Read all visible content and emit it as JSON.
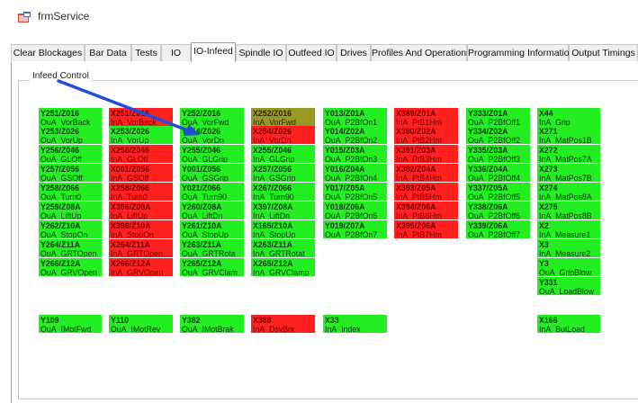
{
  "window": {
    "title": "frmService",
    "icon": "app-form-icon"
  },
  "tabs": [
    {
      "label": "Clear Blockages",
      "active": false
    },
    {
      "label": "Bar Data",
      "active": false
    },
    {
      "label": "Tests",
      "active": false
    },
    {
      "label": "IO",
      "active": false
    },
    {
      "label": "IO-Infeed",
      "active": true
    },
    {
      "label": "Spindle IO",
      "active": false
    },
    {
      "label": "Outfeed IO",
      "active": false
    },
    {
      "label": "Drives",
      "active": false
    },
    {
      "label": "Profiles And Operations",
      "active": false
    },
    {
      "label": "Programming Information",
      "active": false
    },
    {
      "label": "Output Timings",
      "active": false
    }
  ],
  "group": {
    "label": "Infeed Control"
  },
  "colors": {
    "on": "#22ee22",
    "off": "#ff2020",
    "forced": "#999922",
    "annotation_arrow": "#1f4fd8"
  },
  "annotation": {
    "type": "arrow",
    "icon": "pointer-arrow-icon",
    "color": "#1f4fd8"
  },
  "columns": [
    [
      {
        "addr": "Y251/Z016",
        "sig": "OuA_VorBack",
        "state": "on"
      },
      {
        "addr": "Y253/Z026",
        "sig": "OuA_VorUp",
        "state": "on"
      },
      {
        "addr": "Y256/Z046",
        "sig": "OuA_GLOff",
        "state": "on"
      },
      {
        "addr": "Y257/Z056",
        "sig": "OuA_GSOff",
        "state": "on"
      },
      {
        "addr": "Y258/Z066",
        "sig": "OuA_Turn0",
        "state": "on"
      },
      {
        "addr": "Y259/Z08A",
        "sig": "OuA_LiftUp",
        "state": "on"
      },
      {
        "addr": "Y262/Z10A",
        "sig": "OuA_StopOn",
        "state": "on"
      },
      {
        "addr": "Y264/Z11A",
        "sig": "OuA_GRTOpen",
        "state": "on"
      },
      {
        "addr": "Y266/Z12A",
        "sig": "OuA_GRVOpen",
        "state": "on"
      },
      {
        "gap": true
      },
      {
        "addr": "Y109",
        "sig": "OuA_IMotFwd",
        "state": "on"
      }
    ],
    [
      {
        "addr": "X251/Z016",
        "sig": "InA_VorBack",
        "state": "off"
      },
      {
        "addr": "X253/Z026",
        "sig": "InA_VorUp",
        "state": "on"
      },
      {
        "addr": "X256/Z046",
        "sig": "InA_GLOff",
        "state": "off"
      },
      {
        "addr": "X001/Z056",
        "sig": "InA_GSOff",
        "state": "off"
      },
      {
        "addr": "X258/Z066",
        "sig": "InA_Turn0",
        "state": "off"
      },
      {
        "addr": "X396/Z08A",
        "sig": "InA_LiftUp",
        "state": "off"
      },
      {
        "addr": "X398/Z10A",
        "sig": "InA_StopOn",
        "state": "off"
      },
      {
        "addr": "X264/Z11A",
        "sig": "InA_GRTOpen",
        "state": "off"
      },
      {
        "addr": "X266/Z12A",
        "sig": "InA_GRVOpen",
        "state": "off"
      },
      {
        "gap": true
      },
      {
        "addr": "Y110",
        "sig": "OuA_IMotRev",
        "state": "on"
      }
    ],
    [
      {
        "addr": "Y252/Z016",
        "sig": "OuA_VorFwd",
        "state": "on"
      },
      {
        "addr": "Y254/Z026",
        "sig": "OuA_VorDn",
        "state": "on"
      },
      {
        "addr": "Y255/Z046",
        "sig": "OuA_GLGrip",
        "state": "on"
      },
      {
        "addr": "Y001/Z056",
        "sig": "OuA_GSGrip",
        "state": "on"
      },
      {
        "addr": "Y021/Z066",
        "sig": "OuA_Turn90",
        "state": "on"
      },
      {
        "addr": "Y260/Z08A",
        "sig": "OuA_LiftDn",
        "state": "on"
      },
      {
        "addr": "Y261/Z10A",
        "sig": "OuA_StopUp",
        "state": "on"
      },
      {
        "addr": "Y263/Z11A",
        "sig": "OuA_GRTRota",
        "state": "on"
      },
      {
        "addr": "Y265/Z12A",
        "sig": "OuA_GRVClam",
        "state": "on"
      },
      {
        "gap": true
      },
      {
        "addr": "Y382",
        "sig": "OuA_IMotBrak",
        "state": "on"
      }
    ],
    [
      {
        "addr": "X252/Z016",
        "sig": "InA_VorFwd",
        "state": "forced"
      },
      {
        "addr": "X254/Z026",
        "sig": "InA_VorDn",
        "state": "off"
      },
      {
        "addr": "X255/Z046",
        "sig": "InA_GLGrip",
        "state": "on"
      },
      {
        "addr": "X257/Z056",
        "sig": "InA_GSGrip",
        "state": "on"
      },
      {
        "addr": "X267/Z066",
        "sig": "InA_Turn90",
        "state": "on"
      },
      {
        "addr": "X397/Z08A",
        "sig": "InA_LiftDn",
        "state": "on"
      },
      {
        "addr": "X165/Z10A",
        "sig": "InA_StopUp",
        "state": "on"
      },
      {
        "addr": "X263/Z11A",
        "sig": "InA_GRTRotat",
        "state": "on"
      },
      {
        "addr": "X265/Z12A",
        "sig": "InA_GRVClamp",
        "state": "on"
      },
      {
        "gap": true
      },
      {
        "addr": "X388",
        "sig": "InA_DsvBrk",
        "state": "off"
      }
    ],
    [
      {
        "addr": "Y013/Z01A",
        "sig": "OuA_P2BfOn1",
        "state": "on"
      },
      {
        "addr": "Y014/Z02A",
        "sig": "OuA_P2BfOn2",
        "state": "on"
      },
      {
        "addr": "Y015/Z03A",
        "sig": "OuA_P2BfOn3",
        "state": "on"
      },
      {
        "addr": "Y016/Z04A",
        "sig": "OuA_P2BfOn4",
        "state": "on"
      },
      {
        "addr": "Y017/Z05A",
        "sig": "OuA_P2BfOn5",
        "state": "on"
      },
      {
        "addr": "Y018/Z06A",
        "sig": "OuA_P2BfOn6",
        "state": "on"
      },
      {
        "addr": "Y019/Z07A",
        "sig": "OuA_P2BfOn7",
        "state": "on"
      },
      {
        "gap": true
      },
      {
        "gap": true
      },
      {
        "gap": true
      },
      {
        "addr": "X33",
        "sig": "InA_Index",
        "state": "on"
      }
    ],
    [
      {
        "addr": "X389/Z01A",
        "sig": "InA_PtB1Hm",
        "state": "off"
      },
      {
        "addr": "X390/Z02A",
        "sig": "InA_PtB2Hm",
        "state": "off"
      },
      {
        "addr": "X391/Z03A",
        "sig": "InA_PtB3Hm",
        "state": "off"
      },
      {
        "addr": "X392/Z04A",
        "sig": "InA_PtB4Hm",
        "state": "off"
      },
      {
        "addr": "X393/Z05A",
        "sig": "InA_PtB5Hm",
        "state": "off"
      },
      {
        "addr": "X394/Z06A",
        "sig": "InA_PtB6Hm",
        "state": "off"
      },
      {
        "addr": "X395/Z06A",
        "sig": "InA_PtB7Hm",
        "state": "off"
      }
    ],
    [
      {
        "addr": "Y333/Z01A",
        "sig": "OuA_P2BfOff1",
        "state": "on"
      },
      {
        "addr": "Y334/Z02A",
        "sig": "OuA_P2BfOff2",
        "state": "on"
      },
      {
        "addr": "Y335/Z03A",
        "sig": "OuA_P2BfOff3",
        "state": "on"
      },
      {
        "addr": "Y336/Z04A",
        "sig": "OuA_P2BfOff4",
        "state": "on"
      },
      {
        "addr": "Y337/Z05A",
        "sig": "OuA_P2BfOff5",
        "state": "on"
      },
      {
        "addr": "Y338/Z06A",
        "sig": "OuA_P2BfOff6",
        "state": "on"
      },
      {
        "addr": "Y339/Z06A",
        "sig": "OuA_P2BfOff7",
        "state": "on"
      }
    ],
    [
      {
        "addr": "X44",
        "sig": "InA_Grip",
        "state": "on"
      },
      {
        "addr": "X271",
        "sig": "InA_MatPos1B",
        "state": "on"
      },
      {
        "addr": "X272",
        "sig": "InA_MatPos7A",
        "state": "on"
      },
      {
        "addr": "X273",
        "sig": "InA_MatPos7B",
        "state": "on"
      },
      {
        "addr": "X274",
        "sig": "InA_MatPos8A",
        "state": "on"
      },
      {
        "addr": "X275",
        "sig": "InA_MatPos8B",
        "state": "on"
      },
      {
        "addr": "X2",
        "sig": "InA_Measure1",
        "state": "on"
      },
      {
        "addr": "X3",
        "sig": "InA_Measure2",
        "state": "on"
      },
      {
        "addr": "Y3",
        "sig": "OuA_GripBlow",
        "state": "on"
      },
      {
        "addr": "Y331",
        "sig": "OuA_LoadBlow",
        "state": "on"
      },
      {
        "addr": "X166",
        "sig": "InA_ButLoad",
        "state": "on"
      }
    ]
  ]
}
